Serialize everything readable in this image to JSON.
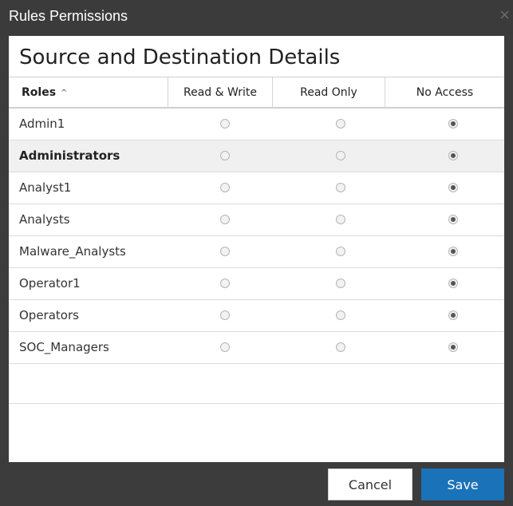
{
  "window": {
    "title": "Rules Permissions",
    "close_label": "×"
  },
  "main": {
    "heading": "Source and Destination Details"
  },
  "table": {
    "columns": [
      "Roles",
      "Read & Write",
      "Read Only",
      "No Access"
    ],
    "sort_indicator": "^",
    "rows": [
      {
        "role": "Admin1",
        "selected": false,
        "permission": "No Access"
      },
      {
        "role": "Administrators",
        "selected": true,
        "permission": "No Access"
      },
      {
        "role": "Analyst1",
        "selected": false,
        "permission": "No Access"
      },
      {
        "role": "Analysts",
        "selected": false,
        "permission": "No Access"
      },
      {
        "role": "Malware_Analysts",
        "selected": false,
        "permission": "No Access"
      },
      {
        "role": "Operator1",
        "selected": false,
        "permission": "No Access"
      },
      {
        "role": "Operators",
        "selected": false,
        "permission": "No Access"
      },
      {
        "role": "SOC_Managers",
        "selected": false,
        "permission": "No Access"
      }
    ]
  },
  "footer": {
    "cancel_label": "Cancel",
    "save_label": "Save"
  },
  "colors": {
    "titlebar": "#3b3b3b",
    "save_button": "#1a73b8",
    "selected_row": "#f0f0f0"
  }
}
